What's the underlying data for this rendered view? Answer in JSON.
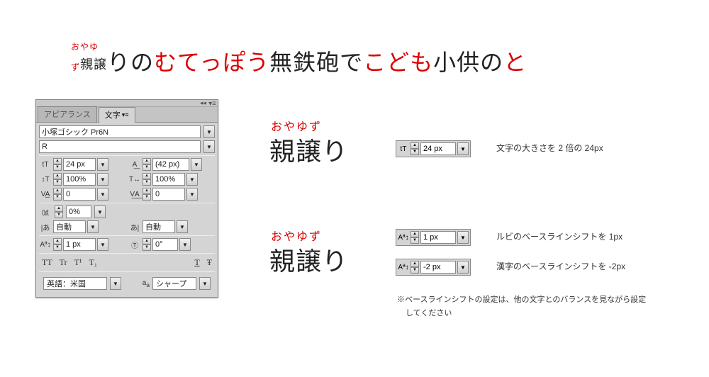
{
  "sample": {
    "ruby_top": "おやゆ",
    "ruby_bot": "ず",
    "ruby_base": "親譲",
    "after_ruby": "りの",
    "red1": "むてっぽう",
    "black1": "無鉄砲で",
    "red2": "こども",
    "black2": "小供の",
    "red3": "と"
  },
  "panel": {
    "tab_appearance": "アピアランス",
    "tab_char": "文字",
    "font_family": "小塚ゴシック Pr6N",
    "font_style": "R",
    "size": "24 px",
    "leading": "(42 px)",
    "vscale": "100%",
    "hscale": "100%",
    "kerning": "0",
    "tracking": "0",
    "tsume": "0%",
    "kinsoku_l": "自動",
    "kinsoku_r": "自動",
    "baseline": "1 px",
    "rotation": "0°",
    "lang": "英語：米国",
    "aa": "シャープ"
  },
  "ex1": {
    "ruby": "おやゆず",
    "base": "親譲り"
  },
  "ctrl_size": {
    "icon": "tT",
    "value": "24 px"
  },
  "note_size": "文字の大きさを 2 倍の 24px",
  "ex2": {
    "ruby": "おやゆず",
    "base": "親譲り"
  },
  "ctrl_bshift1": {
    "value": "1 px"
  },
  "ctrl_bshift2": {
    "value": "-2 px"
  },
  "note_b1": "ルビのベースラインシフトを 1px",
  "note_b2": "漢字のベースラインシフトを -2px",
  "footnote_1": "※ベースラインシフトの設定は、他の文字とのバランスを見ながら設定",
  "footnote_2": "してください",
  "typo": {
    "tt1": "TT",
    "tt2": "Tr",
    "sup": "T¹",
    "sub": "T₁",
    "under": "T",
    "strike": "Ŧ"
  }
}
